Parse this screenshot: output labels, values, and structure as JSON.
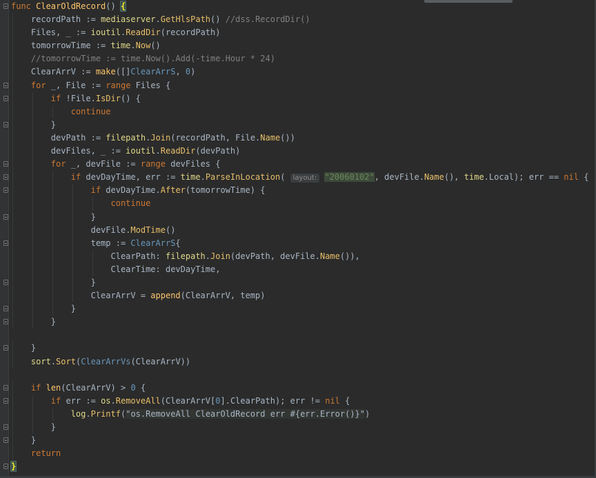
{
  "code_lines": [
    {
      "indent": 0,
      "fold": true,
      "tokens": [
        [
          "kw",
          "func "
        ],
        [
          "fn",
          "ClearOldRecord"
        ],
        [
          "plain",
          "() "
        ],
        [
          "brace",
          "{"
        ]
      ]
    },
    {
      "indent": 1,
      "tokens": [
        [
          "plain",
          "recordPath := "
        ],
        [
          "pkg",
          "mediaserver"
        ],
        [
          "plain",
          "."
        ],
        [
          "mth",
          "GetHlsPath"
        ],
        [
          "plain",
          "() "
        ],
        [
          "cm",
          "//dss.RecordDir()"
        ]
      ]
    },
    {
      "indent": 1,
      "tokens": [
        [
          "plain",
          "Files, _ := "
        ],
        [
          "pkg",
          "ioutil"
        ],
        [
          "plain",
          "."
        ],
        [
          "mth",
          "ReadDir"
        ],
        [
          "plain",
          "(recordPath)"
        ]
      ]
    },
    {
      "indent": 1,
      "tokens": [
        [
          "plain",
          "tomorrowTime := "
        ],
        [
          "pkg",
          "time"
        ],
        [
          "plain",
          "."
        ],
        [
          "mth",
          "Now"
        ],
        [
          "plain",
          "()"
        ]
      ]
    },
    {
      "indent": 1,
      "tokens": [
        [
          "cm",
          "//tomorrowTime := time.Now().Add(-time.Hour * 24)"
        ]
      ]
    },
    {
      "indent": 1,
      "tokens": [
        [
          "plain",
          "ClearArrV := "
        ],
        [
          "fn",
          "make"
        ],
        [
          "plain",
          "([]"
        ],
        [
          "type",
          "ClearArrS"
        ],
        [
          "plain",
          ", "
        ],
        [
          "num",
          "0"
        ],
        [
          "plain",
          ")"
        ]
      ]
    },
    {
      "indent": 1,
      "fold": true,
      "tokens": [
        [
          "kw",
          "for "
        ],
        [
          "plain",
          "_, File := "
        ],
        [
          "kw",
          "range "
        ],
        [
          "plain",
          "Files {"
        ]
      ]
    },
    {
      "indent": 2,
      "fold": true,
      "tokens": [
        [
          "kw",
          "if "
        ],
        [
          "plain",
          "!File."
        ],
        [
          "mth",
          "IsDir"
        ],
        [
          "plain",
          "() {"
        ]
      ]
    },
    {
      "indent": 3,
      "tokens": [
        [
          "kw",
          "continue"
        ]
      ]
    },
    {
      "indent": 2,
      "fold": true,
      "tokens": [
        [
          "plain",
          "}"
        ]
      ]
    },
    {
      "indent": 2,
      "tokens": [
        [
          "plain",
          "devPath := "
        ],
        [
          "pkg",
          "filepath"
        ],
        [
          "plain",
          "."
        ],
        [
          "mth",
          "Join"
        ],
        [
          "plain",
          "(recordPath, File."
        ],
        [
          "mth",
          "Name"
        ],
        [
          "plain",
          "())"
        ]
      ]
    },
    {
      "indent": 2,
      "tokens": [
        [
          "plain",
          "devFiles, _ := "
        ],
        [
          "pkg",
          "ioutil"
        ],
        [
          "plain",
          "."
        ],
        [
          "mth",
          "ReadDir"
        ],
        [
          "plain",
          "(devPath)"
        ]
      ]
    },
    {
      "indent": 2,
      "fold": true,
      "tokens": [
        [
          "kw",
          "for "
        ],
        [
          "plain",
          "_, devFile := "
        ],
        [
          "kw",
          "range "
        ],
        [
          "plain",
          "devFiles {"
        ]
      ]
    },
    {
      "indent": 3,
      "fold": true,
      "tokens": [
        [
          "kw",
          "if "
        ],
        [
          "plain",
          "devDayTime, err := "
        ],
        [
          "pkg",
          "time"
        ],
        [
          "plain",
          "."
        ],
        [
          "mth",
          "ParseInLocation"
        ],
        [
          "plain",
          "( "
        ],
        [
          "hint",
          "layout:"
        ],
        [
          "plain",
          " "
        ],
        [
          "hlstr",
          "\"20060102\""
        ],
        [
          "plain",
          ", devFile."
        ],
        [
          "mth",
          "Name"
        ],
        [
          "plain",
          "(), "
        ],
        [
          "pkg",
          "time"
        ],
        [
          "plain",
          "."
        ],
        [
          "field",
          "Local"
        ],
        [
          "plain",
          "); err == "
        ],
        [
          "kw",
          "nil"
        ],
        [
          "plain",
          " {"
        ]
      ]
    },
    {
      "indent": 4,
      "fold": true,
      "tokens": [
        [
          "kw",
          "if "
        ],
        [
          "plain",
          "devDayTime."
        ],
        [
          "mth",
          "After"
        ],
        [
          "plain",
          "(tomorrowTime) {"
        ]
      ]
    },
    {
      "indent": 5,
      "tokens": [
        [
          "kw",
          "continue"
        ]
      ]
    },
    {
      "indent": 4,
      "fold": true,
      "tokens": [
        [
          "plain",
          "}"
        ]
      ]
    },
    {
      "indent": 4,
      "tokens": [
        [
          "plain",
          "devFile."
        ],
        [
          "mth",
          "ModTime"
        ],
        [
          "plain",
          "()"
        ]
      ]
    },
    {
      "indent": 4,
      "fold": true,
      "tokens": [
        [
          "plain",
          "temp := "
        ],
        [
          "type",
          "ClearArrS"
        ],
        [
          "plain",
          "{"
        ]
      ]
    },
    {
      "indent": 5,
      "tokens": [
        [
          "plain",
          "ClearPath: "
        ],
        [
          "pkg",
          "filepath"
        ],
        [
          "plain",
          "."
        ],
        [
          "mth",
          "Join"
        ],
        [
          "plain",
          "(devPath, devFile."
        ],
        [
          "mth",
          "Name"
        ],
        [
          "plain",
          "()),"
        ]
      ]
    },
    {
      "indent": 5,
      "tokens": [
        [
          "plain",
          "ClearTime: devDayTime,"
        ]
      ]
    },
    {
      "indent": 4,
      "fold": true,
      "tokens": [
        [
          "plain",
          "}"
        ]
      ]
    },
    {
      "indent": 4,
      "tokens": [
        [
          "plain",
          "ClearArrV = "
        ],
        [
          "fn",
          "append"
        ],
        [
          "plain",
          "(ClearArrV, temp)"
        ]
      ]
    },
    {
      "indent": 3,
      "fold": true,
      "tokens": [
        [
          "plain",
          "}"
        ]
      ]
    },
    {
      "indent": 2,
      "fold": true,
      "tokens": [
        [
          "plain",
          "}"
        ]
      ]
    },
    {
      "indent": 0,
      "tokens": []
    },
    {
      "indent": 1,
      "fold": true,
      "tokens": [
        [
          "plain",
          "}"
        ]
      ]
    },
    {
      "indent": 1,
      "tokens": [
        [
          "pkg",
          "sort"
        ],
        [
          "plain",
          "."
        ],
        [
          "mth",
          "Sort"
        ],
        [
          "plain",
          "("
        ],
        [
          "type",
          "ClearArrVs"
        ],
        [
          "plain",
          "(ClearArrV))"
        ]
      ]
    },
    {
      "indent": 0,
      "tokens": []
    },
    {
      "indent": 1,
      "fold": true,
      "tokens": [
        [
          "kw",
          "if "
        ],
        [
          "fn",
          "len"
        ],
        [
          "plain",
          "(ClearArrV) > "
        ],
        [
          "num",
          "0"
        ],
        [
          "plain",
          " {"
        ]
      ]
    },
    {
      "indent": 2,
      "fold": true,
      "tokens": [
        [
          "kw",
          "if "
        ],
        [
          "plain",
          "err := "
        ],
        [
          "pkg",
          "os"
        ],
        [
          "plain",
          "."
        ],
        [
          "mth",
          "RemoveAll"
        ],
        [
          "plain",
          "(ClearArrV["
        ],
        [
          "num",
          "0"
        ],
        [
          "plain",
          "].ClearPath); err != "
        ],
        [
          "kw",
          "nil"
        ],
        [
          "plain",
          " {"
        ]
      ]
    },
    {
      "indent": 3,
      "tokens": [
        [
          "pkg",
          "log"
        ],
        [
          "plain",
          "."
        ],
        [
          "mth",
          "Printf"
        ],
        [
          "plain",
          "("
        ],
        [
          "tmpl",
          "\"os.RemoveAll ClearOldRecord err #{err.Error()}\""
        ],
        [
          "plain",
          ")"
        ]
      ]
    },
    {
      "indent": 2,
      "fold": true,
      "tokens": [
        [
          "plain",
          "}"
        ]
      ]
    },
    {
      "indent": 1,
      "fold": true,
      "tokens": [
        [
          "plain",
          "}"
        ]
      ]
    },
    {
      "indent": 1,
      "tokens": [
        [
          "kw",
          "return"
        ]
      ]
    },
    {
      "indent": 0,
      "fold": true,
      "tokens": [
        [
          "brace",
          "}"
        ]
      ]
    }
  ]
}
